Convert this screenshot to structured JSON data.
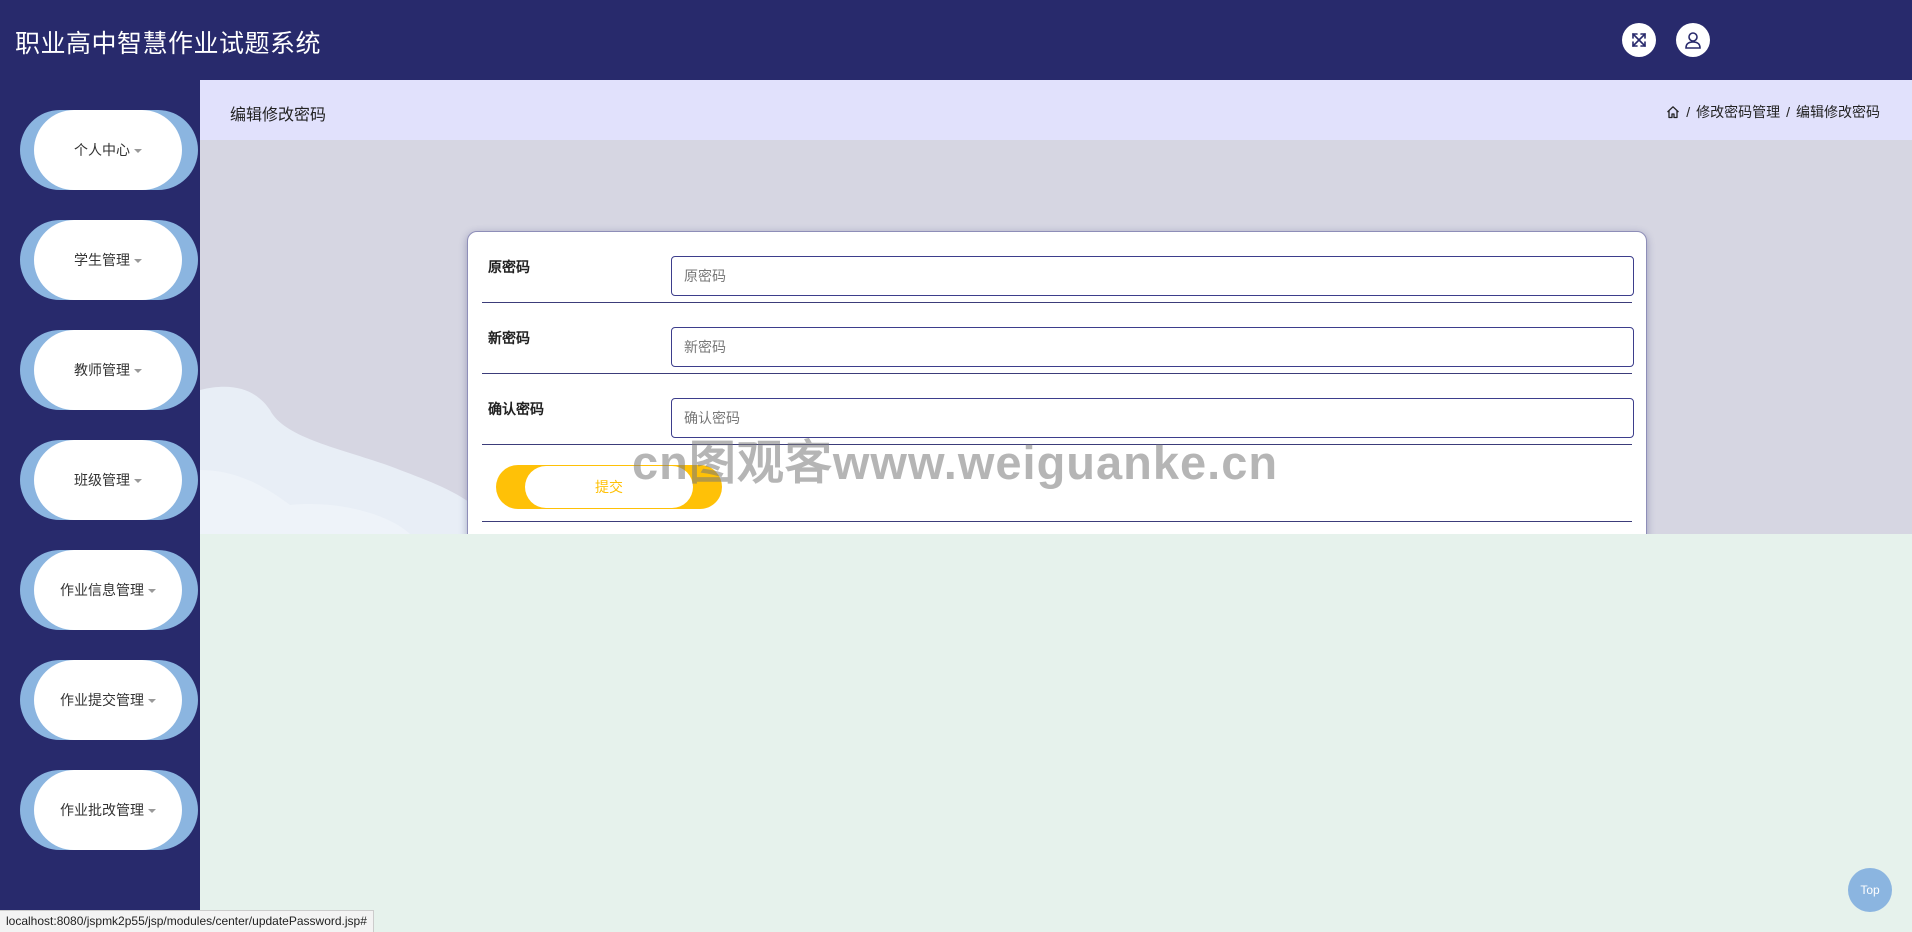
{
  "app": {
    "title": "职业高中智慧作业试题系统"
  },
  "header": {
    "fullscreen_icon": "expand-arrows-icon",
    "user_icon": "user-icon"
  },
  "sidebar": {
    "items": [
      {
        "label": "个人中心"
      },
      {
        "label": "学生管理"
      },
      {
        "label": "教师管理"
      },
      {
        "label": "班级管理"
      },
      {
        "label": "作业信息管理"
      },
      {
        "label": "作业提交管理"
      },
      {
        "label": "作业批改管理"
      }
    ]
  },
  "page": {
    "title": "编辑修改密码",
    "breadcrumb": [
      "修改密码管理",
      "编辑修改密码"
    ],
    "breadcrumb_separator": "/"
  },
  "form": {
    "fields": [
      {
        "label": "原密码",
        "placeholder": "原密码",
        "value": ""
      },
      {
        "label": "新密码",
        "placeholder": "新密码",
        "value": ""
      },
      {
        "label": "确认密码",
        "placeholder": "确认密码",
        "value": ""
      }
    ],
    "submit_label": "提交"
  },
  "watermark": "cn图观客www.weiguanke.cn",
  "status_url": "localhost:8080/jspmk2p55/jsp/modules/center/updatePassword.jsp#",
  "top_button_label": "Top",
  "colors": {
    "header_bg": "#282a6c",
    "accent_blue": "#8bb5e0",
    "accent_yellow": "#ffc107",
    "breadcrumb_bg": "#e1e1fc",
    "content_bg": "#e6f2ec"
  }
}
